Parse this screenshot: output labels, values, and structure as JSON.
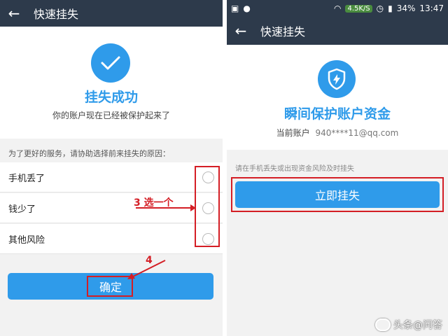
{
  "left_screen": {
    "titlebar": {
      "back_glyph": "←",
      "title": "快速挂失"
    },
    "success_icon": "checkmark-icon",
    "headline": "挂失成功",
    "subline": "你的账户现在已经被保护起来了",
    "hint": "为了更好的服务，请协助选择前来挂失的原因：",
    "options": [
      {
        "label": "手机丢了",
        "selected": false
      },
      {
        "label": "钱少了",
        "selected": false
      },
      {
        "label": "其他风险",
        "selected": false
      }
    ],
    "confirm_label": "确定",
    "annotations": {
      "step3": "3 选一个",
      "step4": "4"
    }
  },
  "right_screen": {
    "status_bar": {
      "speed": "4.5K/S",
      "battery": "34%",
      "time": "13:47"
    },
    "titlebar": {
      "back_glyph": "←",
      "title": "快速挂失"
    },
    "shield_icon": "shield-lightning-icon",
    "headline": "瞬间保护账户资金",
    "account_label": "当前账户",
    "account_value": "940****11@qq.com",
    "hint": "请在手机丢失或出现资金风险及时挂失",
    "action_label": "立即挂失"
  },
  "watermark": {
    "text": "头条@问答"
  },
  "colors": {
    "accent": "#2f9bea",
    "titlebar": "#2d3a4b",
    "annotation": "#d41e25"
  }
}
